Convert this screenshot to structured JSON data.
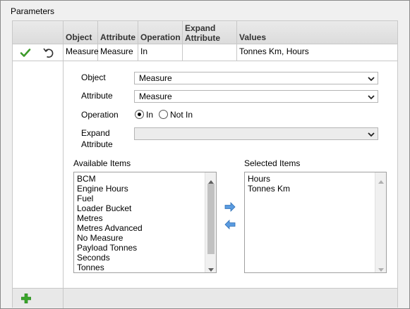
{
  "window": {
    "title": "Parameters"
  },
  "grid": {
    "columns": [
      "",
      "Object",
      "Attribute",
      "Operation",
      "Expand Attribute",
      "Values"
    ],
    "row": {
      "object": "Measure",
      "attribute": "Measure",
      "operation": "In",
      "expand_attribute": "",
      "values": "Tonnes Km, Hours"
    }
  },
  "editor": {
    "object_label": "Object",
    "object_value": "Measure",
    "attribute_label": "Attribute",
    "attribute_value": "Measure",
    "operation_label": "Operation",
    "operation_options": [
      "In",
      "Not In"
    ],
    "operation_selected": "In",
    "expand_attribute_label_line1": "Expand",
    "expand_attribute_label_line2": "Attribute",
    "expand_attribute_value": ""
  },
  "available": {
    "label": "Available Items",
    "items": [
      "BCM",
      "Engine Hours",
      "Fuel",
      "Loader Bucket",
      "Metres",
      "Metres Advanced",
      "No Measure",
      "Payload Tonnes",
      "Seconds",
      "Tonnes"
    ]
  },
  "selected": {
    "label": "Selected Items",
    "items": [
      "Hours",
      "Tonnes Km"
    ]
  },
  "icons": {
    "confirm": "check-icon",
    "undo": "undo-icon",
    "add": "plus-icon",
    "move_right": "arrow-right-icon",
    "move_left": "arrow-left-icon"
  },
  "colors": {
    "check_green": "#3c9a2a",
    "add_green": "#3aa62b",
    "arrow_blue": "#4a90d9"
  }
}
